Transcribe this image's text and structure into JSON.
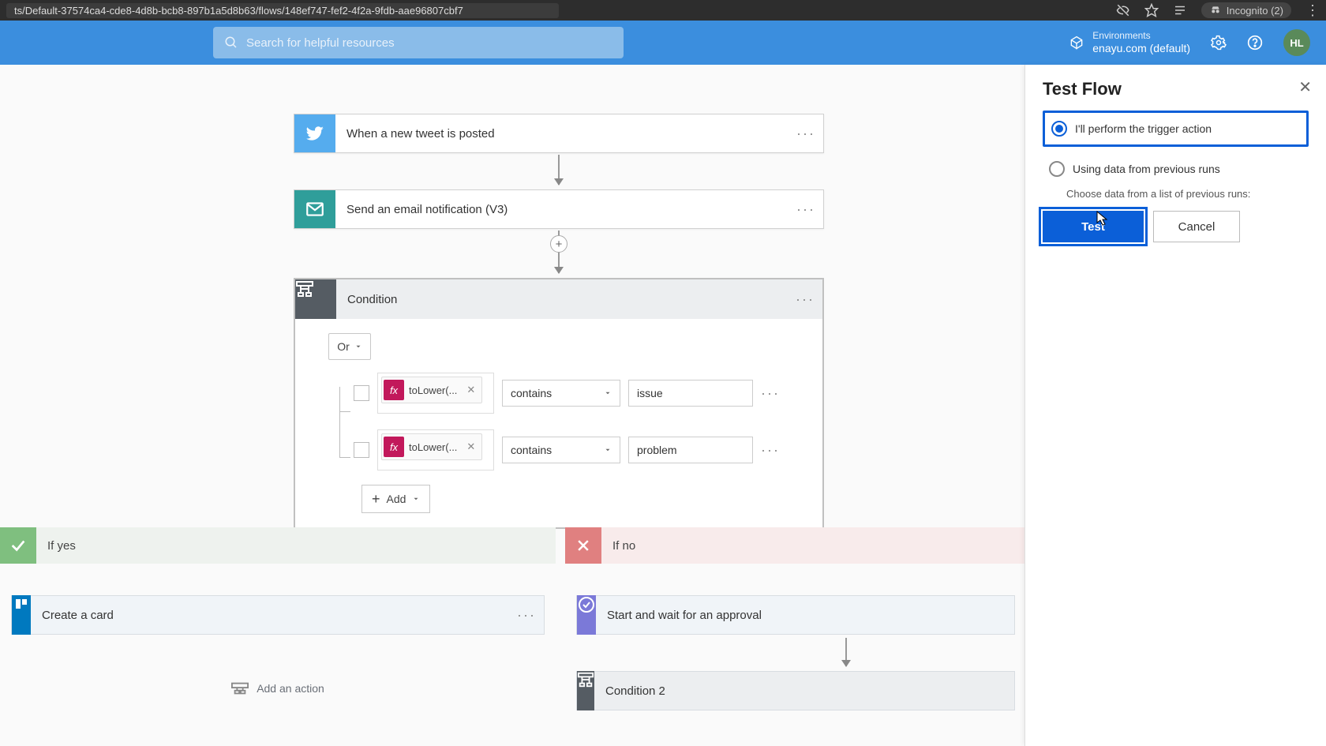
{
  "browser": {
    "url": "ts/Default-37574ca4-cde8-4d8b-bcb8-897b1a5d8b63/flows/148ef747-fef2-4f2a-9fdb-aae96807cbf7",
    "incognito": "Incognito (2)"
  },
  "header": {
    "search_placeholder": "Search for helpful resources",
    "env_label": "Environments",
    "env_name": "enayu.com (default)",
    "avatar": "HL"
  },
  "flow": {
    "trigger": {
      "title": "When a new tweet is posted"
    },
    "email": {
      "title": "Send an email notification (V3)"
    },
    "condition": {
      "title": "Condition",
      "group_op": "Or",
      "rows": [
        {
          "fx": "toLower(...",
          "op": "contains",
          "value": "issue"
        },
        {
          "fx": "toLower(...",
          "op": "contains",
          "value": "problem"
        }
      ],
      "add_label": "Add"
    },
    "yes": {
      "label": "If yes",
      "card": "Create a card",
      "add_action": "Add an action"
    },
    "no": {
      "label": "If no",
      "card": "Start and wait for an approval",
      "condition2": "Condition 2"
    }
  },
  "panel": {
    "title": "Test Flow",
    "opt1": "I'll perform the trigger action",
    "opt2": "Using data from previous runs",
    "sub": "Choose data from a list of previous runs:",
    "test": "Test",
    "cancel": "Cancel"
  }
}
